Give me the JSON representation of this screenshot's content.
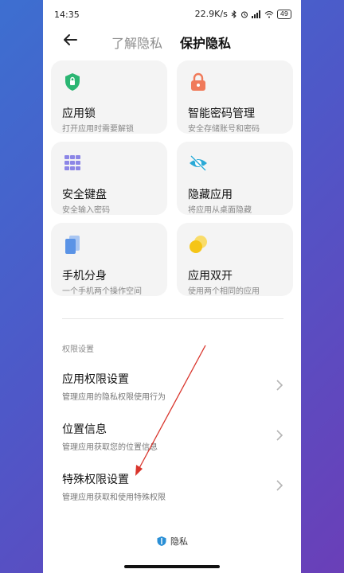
{
  "status": {
    "time": "14:35",
    "network_speed": "22.9K/s",
    "battery": "49"
  },
  "header": {
    "tab_learn": "了解隐私",
    "tab_protect": "保护隐私"
  },
  "features": [
    {
      "title": "应用锁",
      "subtitle": "打开应用时需要解锁",
      "icon": "shield-lock-icon",
      "color": "#2bb673"
    },
    {
      "title": "智能密码管理",
      "subtitle": "安全存储账号和密码",
      "icon": "padlock-icon",
      "color": "#f07a5a"
    },
    {
      "title": "安全键盘",
      "subtitle": "安全输入密码",
      "icon": "keyboard-icon",
      "color": "#8c86e6"
    },
    {
      "title": "隐藏应用",
      "subtitle": "将应用从桌面隐藏",
      "icon": "eye-hidden-icon",
      "color": "#2aa9d6"
    },
    {
      "title": "手机分身",
      "subtitle": "一个手机两个操作空间",
      "icon": "phone-copy-icon",
      "color": "#5a93e6"
    },
    {
      "title": "应用双开",
      "subtitle": "使用两个相同的应用",
      "icon": "dual-app-icon",
      "color": "#f5c517"
    }
  ],
  "permissions": {
    "section_label": "权限设置",
    "items": [
      {
        "title": "应用权限设置",
        "subtitle": "管理应用的隐私权限使用行为"
      },
      {
        "title": "位置信息",
        "subtitle": "管理应用获取您的位置信息"
      },
      {
        "title": "特殊权限设置",
        "subtitle": "管理应用获取和使用特殊权限"
      }
    ]
  },
  "footer": {
    "label": "隐私"
  },
  "colors": {
    "card_bg": "#f4f4f4",
    "annotation_arrow": "#d9342b"
  }
}
